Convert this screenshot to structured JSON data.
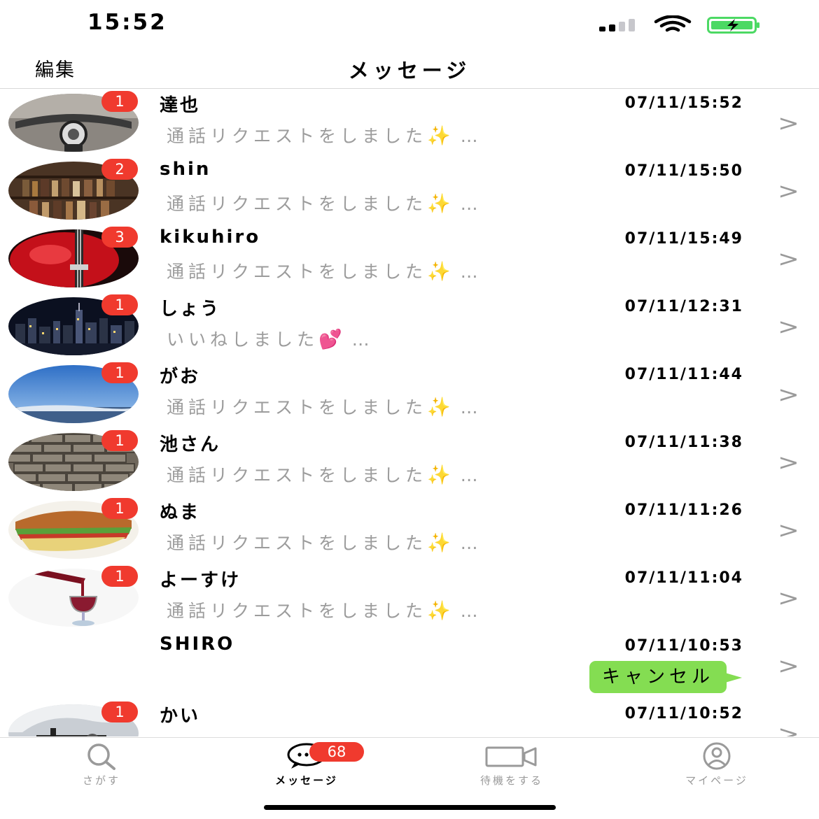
{
  "status_bar": {
    "time": "15:52"
  },
  "nav": {
    "edit_label": "編集",
    "title": "メッセージ"
  },
  "messages": [
    {
      "name": "達也",
      "time": "07/11/15:52",
      "preview": "通話リクエストをしました",
      "emoji": "✨",
      "ellipsis": "…",
      "badge": "1"
    },
    {
      "name": "shin",
      "time": "07/11/15:50",
      "preview": "通話リクエストをしました",
      "emoji": "✨",
      "ellipsis": "…",
      "badge": "2"
    },
    {
      "name": "kikuhiro",
      "time": "07/11/15:49",
      "preview": "通話リクエストをしました",
      "emoji": "✨",
      "ellipsis": "…",
      "badge": "3"
    },
    {
      "name": "しょう",
      "time": "07/11/12:31",
      "preview": "いいねしました",
      "emoji": "💕",
      "ellipsis": "…",
      "badge": "1"
    },
    {
      "name": "がお",
      "time": "07/11/11:44",
      "preview": "通話リクエストをしました",
      "emoji": "✨",
      "ellipsis": "…",
      "badge": "1"
    },
    {
      "name": "池さん",
      "time": "07/11/11:38",
      "preview": "通話リクエストをしました",
      "emoji": "✨",
      "ellipsis": "…",
      "badge": "1"
    },
    {
      "name": "ぬま",
      "time": "07/11/11:26",
      "preview": "通話リクエストをしました",
      "emoji": "✨",
      "ellipsis": "…",
      "badge": "1"
    },
    {
      "name": "よーすけ",
      "time": "07/11/11:04",
      "preview": "通話リクエストをしました",
      "emoji": "✨",
      "ellipsis": "…",
      "badge": "1"
    },
    {
      "name": "SHIRO",
      "time": "07/11/10:53",
      "bubble": "キャンセル"
    },
    {
      "name": "かい",
      "time": "07/11/10:52",
      "badge": "1"
    }
  ],
  "chevron": ">",
  "tabbar": {
    "tabs": [
      {
        "label": "さがす",
        "icon": "search-icon"
      },
      {
        "label": "メッセージ",
        "icon": "chat-bubble-icon",
        "badge": "68"
      },
      {
        "label": "待機をする",
        "icon": "video-camera-icon"
      },
      {
        "label": "マイページ",
        "icon": "person-icon"
      }
    ]
  },
  "colors": {
    "badge": "#f03a2e",
    "bubble": "#84dd52",
    "preview_text": "#9c9c9c",
    "battery": "#4cd964"
  }
}
